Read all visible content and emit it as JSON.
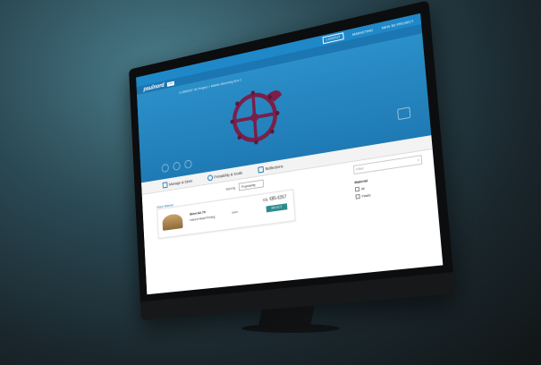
{
  "topbar": {
    "nav_box_label": "LOGOUT",
    "nav_link_1": "MARKETING",
    "nav_link_2": "NEW 3D PROJECT"
  },
  "brand": {
    "logo": "paulnord",
    "flag": "EUR"
  },
  "viewer": {
    "breadcrumb": "CURRENT 3D Project > Mobile Mounting Arm 1"
  },
  "tabs": [
    {
      "label": "Manage & Store",
      "icon": "box-icon"
    },
    {
      "label": "Printability & Scale",
      "icon": "search-icon"
    },
    {
      "label": "Reflections",
      "icon": "expand-icon"
    }
  ],
  "content": {
    "select_material_label": "Select Material",
    "sort_label": "Sort by",
    "sort_value": "Popularity",
    "card": {
      "material_name": "Steel A2-70",
      "process": "Indirect Metal Printing",
      "info": "more",
      "price": "ca. €85-€267",
      "select_label": "SELECT"
    },
    "filter": {
      "placeholder": "Filter",
      "clear_icon": "x",
      "section_title": "Material",
      "options": [
        "All",
        "Plastic"
      ]
    }
  },
  "colors": {
    "primary_blue": "#1e88c9",
    "viewer_blue": "#2b8fc8",
    "select_button": "#2e8b8b",
    "part_color": "#7a1f4a"
  }
}
